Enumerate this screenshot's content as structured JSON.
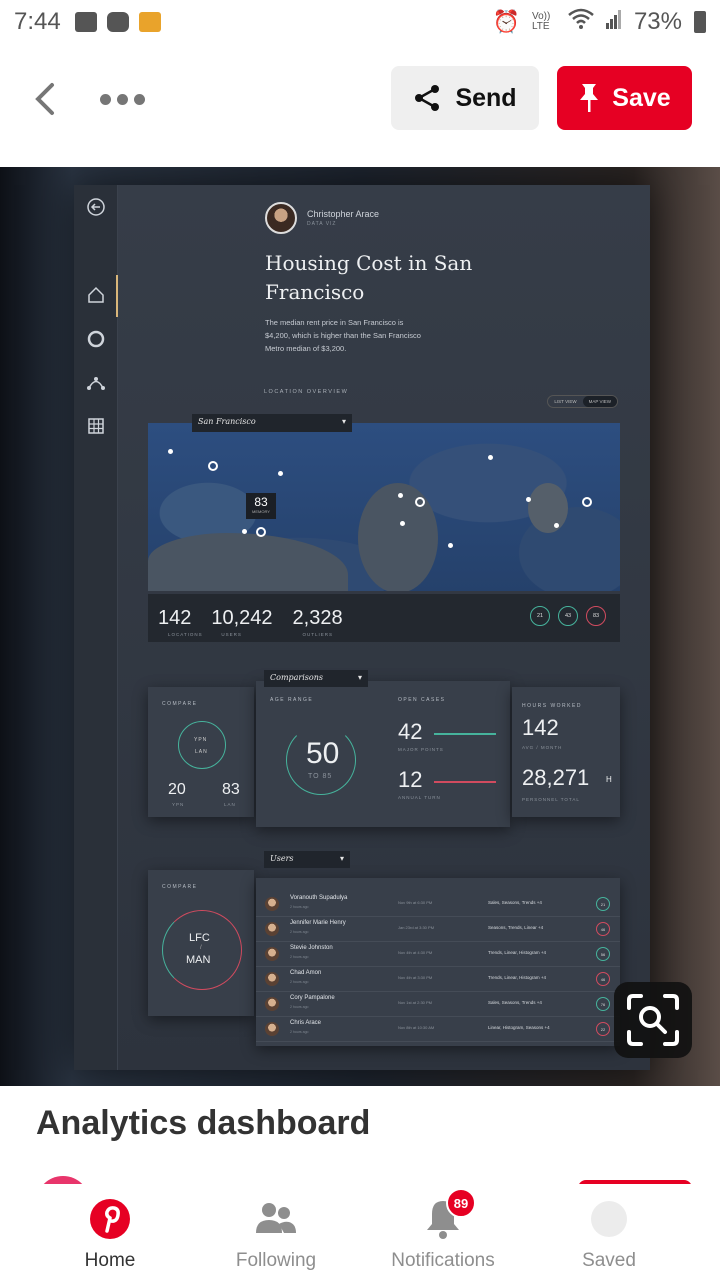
{
  "status_bar": {
    "time": "7:44",
    "volte": "Vo)) LTE",
    "battery": "73%"
  },
  "toolbar": {
    "send_label": "Send",
    "save_label": "Save"
  },
  "pin": {
    "dashboard": {
      "author_name": "Christopher Arace",
      "author_role": "DATA VIZ",
      "title": "Housing Cost in San Francisco",
      "description": "The median rent price in San Francisco is $4,200, which is higher than the San Francisco Metro median of $3,200.",
      "location_label": "LOCATION OVERVIEW",
      "toggle_list": "LIST VIEW",
      "toggle_map": "MAP VIEW",
      "city": "San Francisco",
      "map_badge_value": "83",
      "map_badge_label": "MEMORY",
      "stats": [
        {
          "value": "142",
          "label": "LOCATIONS"
        },
        {
          "value": "10,242",
          "label": "USERS"
        },
        {
          "value": "2,328",
          "label": "OUTLIERS"
        }
      ],
      "stat_circles": [
        "21",
        "43",
        "83"
      ],
      "compare1": {
        "title": "COMPARE",
        "ring_top": "YPN",
        "ring_bottom": "LAN",
        "left_val": "20",
        "left_lbl": "YPN",
        "right_val": "83",
        "right_lbl": "LAN"
      },
      "comparisons_label": "Comparisons",
      "age": {
        "title": "AGE RANGE",
        "value": "50",
        "sub": "TO 85"
      },
      "open_cases": {
        "title": "OPEN CASES",
        "v1": "42",
        "l1": "MAJOR POINTS",
        "v2": "12",
        "l2": "ANNUAL TURN"
      },
      "hours": {
        "title": "HOURS WORKED",
        "v1": "142",
        "l1": "AVG / MONTH",
        "v2": "28,271",
        "unit2": "H",
        "l2": "PERSONNEL TOTAL"
      },
      "compare2": {
        "title": "COMPARE",
        "line1": "LFC",
        "line2": "/",
        "line3": "MAN"
      },
      "users_label": "Users",
      "users": [
        {
          "name": "Voranouth Supadulya",
          "sub": "2 hours ago",
          "date": "Nov 9th at 6:30 PM",
          "tags": "Sales, Seasons, Trends +4",
          "badge": "21",
          "red": false
        },
        {
          "name": "Jennifer Marie Henry",
          "sub": "2 hours ago",
          "date": "Jan 23rd at 3:30 PM",
          "tags": "Seasons, Trends, Linear +4",
          "badge": "46",
          "red": true
        },
        {
          "name": "Stevie Johnston",
          "sub": "2 hours ago",
          "date": "Nov 4th at 4:30 PM",
          "tags": "Trends, Linear, Histogram +4",
          "badge": "56",
          "red": false
        },
        {
          "name": "Chad Amon",
          "sub": "2 hours ago",
          "date": "Nov 4th at 3:30 PM",
          "tags": "Trends, Linear, Histogram +4",
          "badge": "46",
          "red": true
        },
        {
          "name": "Cory Pampalone",
          "sub": "2 hours ago",
          "date": "Nov 1st at 2:30 PM",
          "tags": "Sales, Seasons, Trends +4",
          "badge": "76",
          "red": false
        },
        {
          "name": "Chris Arace",
          "sub": "2 hours ago",
          "date": "Nov 8th at 10:30 AM",
          "tags": "Linear, Histogram, Seasons +4",
          "badge": "22",
          "red": true
        }
      ]
    },
    "title": "Analytics dashboard"
  },
  "nav": {
    "home": "Home",
    "following": "Following",
    "notifications": "Notifications",
    "notification_count": "89",
    "saved": "Saved"
  },
  "colors": {
    "brand": "#e60023",
    "teal": "#46b39c",
    "rose": "#d14b5f"
  }
}
